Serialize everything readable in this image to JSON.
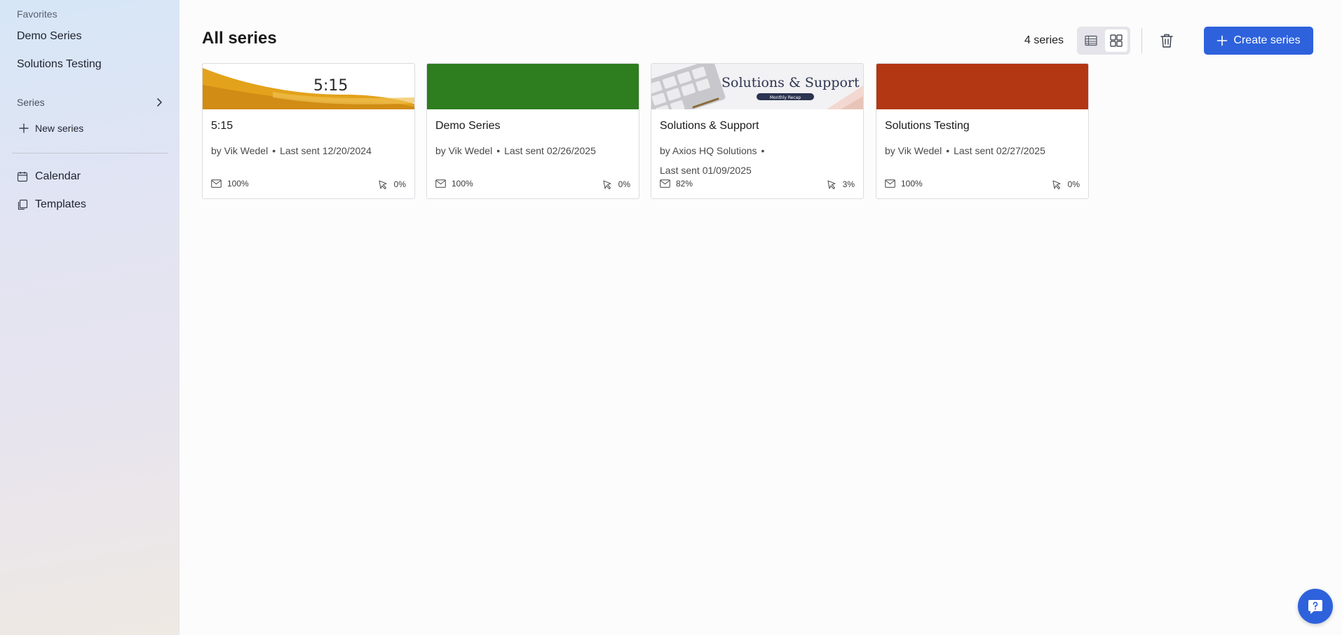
{
  "sidebar": {
    "favorites_label": "Favorites",
    "favorites": [
      "Demo Series",
      "Solutions Testing"
    ],
    "series_label": "Series",
    "new_series_label": "New series",
    "calendar_label": "Calendar",
    "templates_label": "Templates"
  },
  "header": {
    "title": "All series",
    "count": "4 series",
    "create_label": "Create series"
  },
  "cards": [
    {
      "title": "5:15",
      "author": "by Vik Wedel",
      "last_sent": "Last sent 12/20/2024",
      "open_rate": "100%",
      "click_rate": "0%",
      "banner_text": "5:15",
      "banner_color": "#e0a017"
    },
    {
      "title": "Demo Series",
      "author": "by Vik Wedel",
      "last_sent": "Last sent 02/26/2025",
      "open_rate": "100%",
      "click_rate": "0%",
      "banner_color": "#2e7d1f"
    },
    {
      "title": "Solutions & Support",
      "author": "by Axios HQ Solutions",
      "last_sent": "Last sent 01/09/2025",
      "open_rate": "82%",
      "click_rate": "3%",
      "banner_text": "Solutions & Support",
      "banner_sub": "Monthly Recap",
      "banner_color": "#eeeef0"
    },
    {
      "title": "Solutions Testing",
      "author": "by Vik Wedel",
      "last_sent": "Last sent 02/27/2025",
      "open_rate": "100%",
      "click_rate": "0%",
      "banner_color": "#b33713"
    }
  ],
  "colors": {
    "accent": "#2e62dc"
  }
}
